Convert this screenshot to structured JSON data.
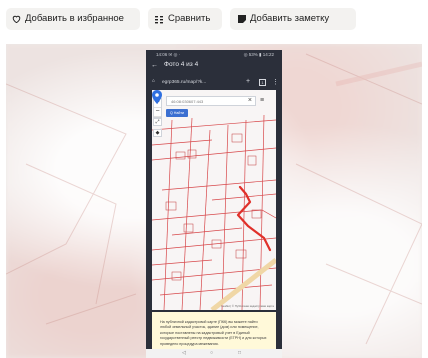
{
  "toolbar": {
    "favorite_label": "Добавить в избранное",
    "compare_label": "Сравнить",
    "note_label": "Добавить заметку"
  },
  "phone": {
    "status_left": "14:06 ✉ ◎ ·",
    "status_right": "◎ 53% ▮ 14:22",
    "title": "Фото 4 из 4",
    "url": "egrp365.ru/map/?k...",
    "map": {
      "search_value": "46:08:030607:443",
      "find_label": "Q Найти",
      "attribution": "Leaflet | © Публичная кадастровая карта"
    },
    "info_text": "На публичной кадастровой карте (ПКК) вы можете найти любой земельный участок, здание (дом) или помещение, которые поставлены на кадастровый учет в Единый государственный реестр недвижимости (ЕГРН) и для которых проведено процедура межевания."
  },
  "colors": {
    "toolbar_bg": "#f3f2f0",
    "phone_bar": "#2b2f3a",
    "find_button": "#3b6fd1",
    "route": "#e0302a",
    "pin": "#2f6fe0",
    "info_bg": "#fff9d9"
  }
}
